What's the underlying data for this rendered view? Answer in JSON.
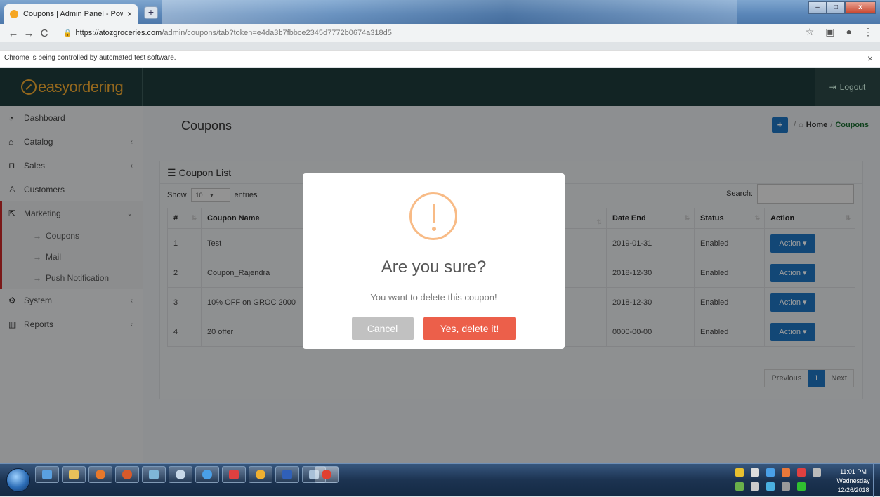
{
  "browser": {
    "tab_title": "Coupons | Admin Panel - Powere",
    "url_host": "https://atozgroceries.com",
    "url_path": "/admin/coupons/tab?token=e4da3b7fbbce2345d7772b0674a318d5",
    "automation_notice": "Chrome is being controlled by automated test software."
  },
  "app": {
    "logo": "easyordering",
    "logout_label": "Logout"
  },
  "sidebar": {
    "items": [
      {
        "label": "Dashboard",
        "icon": "dashboard-icon"
      },
      {
        "label": "Catalog",
        "icon": "tag-icon"
      },
      {
        "label": "Sales",
        "icon": "cart-icon"
      },
      {
        "label": "Customers",
        "icon": "user-icon"
      },
      {
        "label": "Marketing",
        "icon": "share-icon"
      },
      {
        "label": "System",
        "icon": "gear-icon"
      },
      {
        "label": "Reports",
        "icon": "bar-chart-icon"
      }
    ],
    "marketing_sub": [
      "Coupons",
      "Mail",
      "Push Notification"
    ]
  },
  "page": {
    "title": "Coupons",
    "breadcrumb_home": "Home",
    "breadcrumb_current": "Coupons",
    "panel_title": "Coupon List",
    "show_label": "Show",
    "entries_value": "10",
    "entries_label": "entries",
    "search_label": "Search:"
  },
  "table": {
    "headers": [
      "#",
      "Coupon Name",
      "",
      "",
      "",
      "Date End",
      "Status",
      "Action"
    ],
    "rows": [
      {
        "num": "1",
        "name": "Test",
        "date_end": "2019-01-31",
        "status": "Enabled"
      },
      {
        "num": "2",
        "name": "Coupon_Rajendra",
        "date_end": "2018-12-30",
        "status": "Enabled"
      },
      {
        "num": "3",
        "name": "10% OFF on GROC 2000",
        "date_end": "2018-12-30",
        "status": "Enabled"
      },
      {
        "num": "4",
        "name": "20 offer",
        "date_end": "0000-00-00",
        "status": "Enabled"
      }
    ],
    "action_label": "Action"
  },
  "pagination": {
    "prev": "Previous",
    "page": "1",
    "next": "Next"
  },
  "modal": {
    "title": "Are you sure?",
    "text": "You want to delete this coupon!",
    "cancel": "Cancel",
    "confirm": "Yes, delete it!"
  },
  "taskbar": {
    "time": "11:01 PM",
    "day": "Wednesday",
    "date": "12/26/2018"
  }
}
